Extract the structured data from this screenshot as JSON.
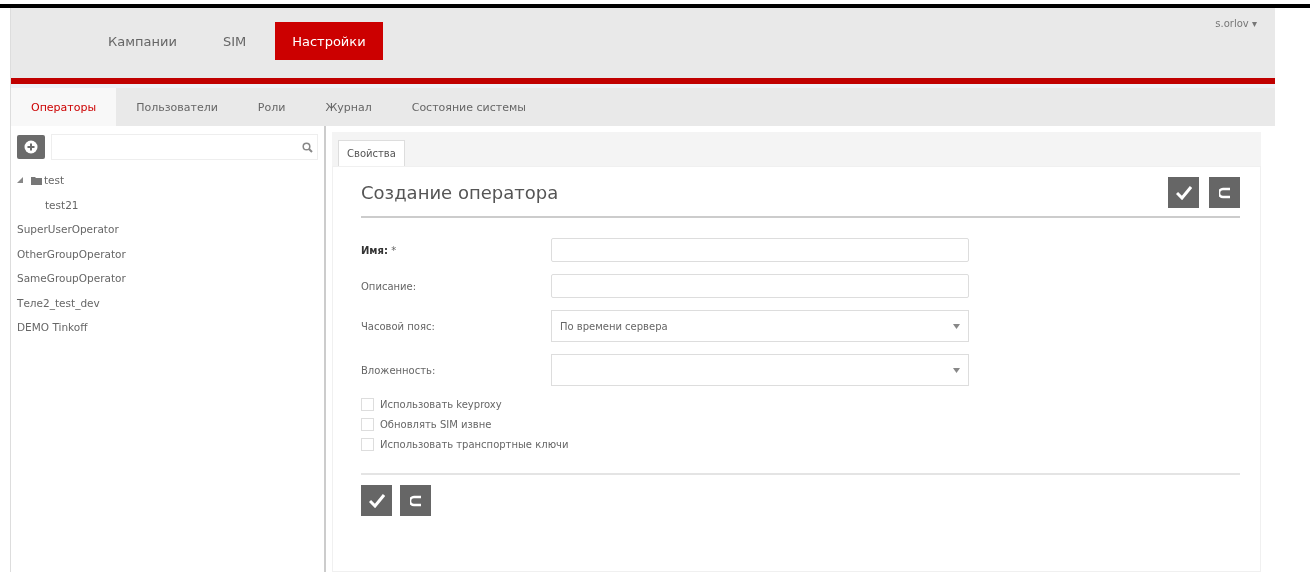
{
  "top_nav": {
    "items": [
      {
        "label": "Кампании",
        "selected": false
      },
      {
        "label": "SIM",
        "selected": false
      },
      {
        "label": "Настройки",
        "selected": true
      }
    ],
    "user_menu": "s.orlov ▾"
  },
  "sub_tabs": [
    {
      "label": "Операторы",
      "selected": true
    },
    {
      "label": "Пользователи",
      "selected": false
    },
    {
      "label": "Роли",
      "selected": false
    },
    {
      "label": "Журнал",
      "selected": false
    },
    {
      "label": "Состояние системы",
      "selected": false
    }
  ],
  "sidebar": {
    "tree": [
      {
        "label": "test",
        "kind": "folder",
        "expanded": true,
        "children": [
          {
            "label": "test21",
            "kind": "item"
          }
        ]
      },
      {
        "label": "SuperUserOperator",
        "kind": "item"
      },
      {
        "label": "OtherGroupOperator",
        "kind": "item"
      },
      {
        "label": "SameGroupOperator",
        "kind": "item"
      },
      {
        "label": "Теле2_test_dev",
        "kind": "item"
      },
      {
        "label": "DEMO Tinkoff",
        "kind": "item"
      }
    ]
  },
  "content": {
    "tabs": [
      {
        "label": "Свойства",
        "selected": true
      }
    ],
    "title": "Создание оператора",
    "fields": [
      {
        "label": "**Имя:** *",
        "kind": "text"
      },
      {
        "label": "Описание:",
        "kind": "text"
      },
      {
        "label": "Часовой пояс:",
        "kind": "select",
        "value": "По времени сервера"
      },
      {
        "label": "Вложенность:",
        "kind": "select"
      }
    ],
    "checkboxes": [
      {
        "label": "Использовать keyproxy",
        "checked": false
      },
      {
        "label": "Обновлять SIM извне",
        "checked": false
      },
      {
        "label": "Использовать транспортные ключи",
        "checked": false
      }
    ]
  }
}
